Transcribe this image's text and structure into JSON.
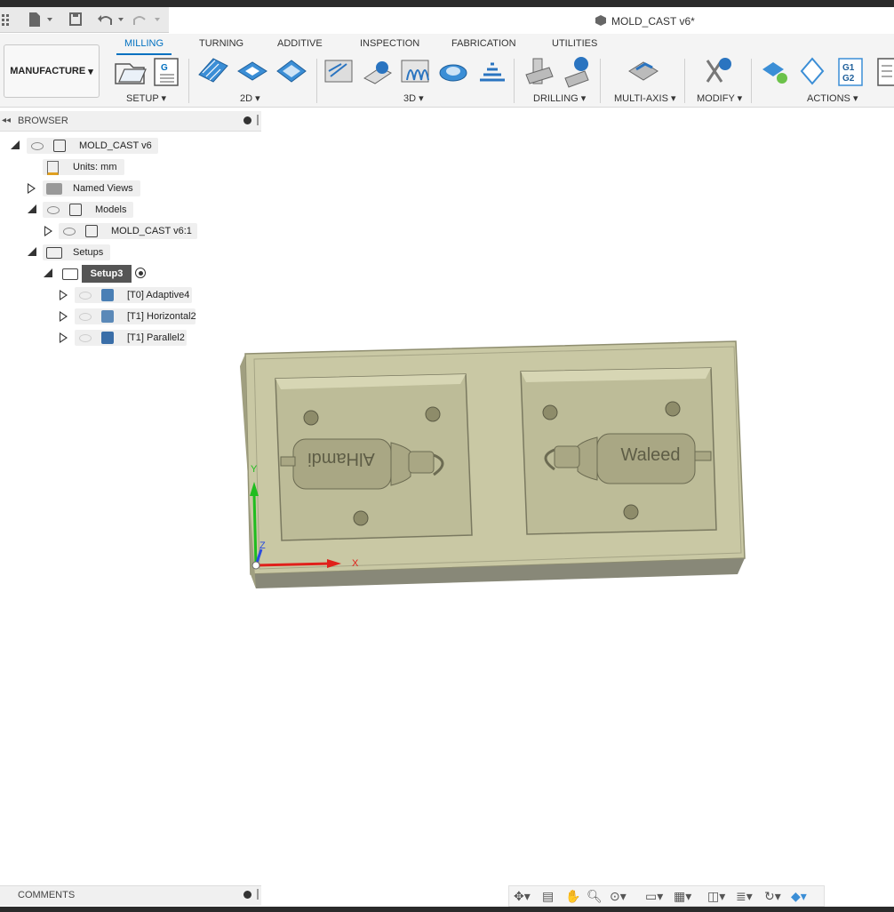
{
  "window": {
    "title": "MOLD_CAST v6*"
  },
  "workspace": {
    "label": "MANUFACTURE"
  },
  "tabs": [
    "MILLING",
    "TURNING",
    "ADDITIVE",
    "INSPECTION",
    "FABRICATION",
    "UTILITIES"
  ],
  "active_tab": "MILLING",
  "tool_groups": {
    "setup": "SETUP",
    "two_d": "2D",
    "three_d": "3D",
    "drilling": "DRILLING",
    "multi_axis": "MULTI-AXIS",
    "modify": "MODIFY",
    "actions": "ACTIONS"
  },
  "setup_icon_letter": "G",
  "actions_icon_text": "G1\nG2",
  "browser": {
    "title": "BROWSER",
    "root": "MOLD_CAST v6",
    "units": "Units: mm",
    "named_views": "Named Views",
    "models": "Models",
    "model_item": "MOLD_CAST v6:1",
    "setups": "Setups",
    "setup": "Setup3",
    "operations": [
      "[T0] Adaptive4",
      "[T1] Horizontal2",
      "[T1] Parallel2"
    ]
  },
  "comments": {
    "title": "COMMENTS"
  },
  "model": {
    "left_text": "AlHamdi",
    "right_text": "Waleed",
    "axis_x": "X",
    "axis_y": "Y",
    "axis_z": "Z"
  },
  "colors": {
    "accent": "#0070c0",
    "mold": "#c9c8a4",
    "axis_x": "#e0201b",
    "axis_y": "#1fbd1f",
    "axis_z": "#2a4ce0"
  }
}
